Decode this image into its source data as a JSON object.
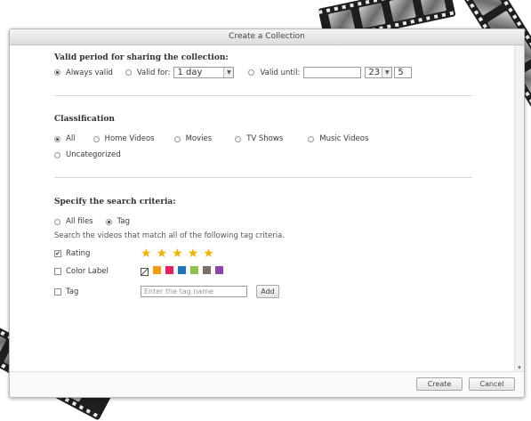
{
  "dialog": {
    "title": "Create a Collection"
  },
  "valid_period": {
    "heading": "Valid period for sharing the collection:",
    "options": {
      "always": "Always valid",
      "valid_for": "Valid for:",
      "valid_until": "Valid until:"
    },
    "selected": "always",
    "valid_for_value": "1 day",
    "valid_until_date": "",
    "hour_value": "23",
    "minute_value": "5"
  },
  "classification": {
    "heading": "Classification",
    "options": [
      "All",
      "Home Videos",
      "Movies",
      "TV Shows",
      "Music Videos",
      "Uncategorized"
    ],
    "selected": "All"
  },
  "search": {
    "heading": "Specify the search criteria:",
    "options": {
      "all_files": "All files",
      "tag": "Tag"
    },
    "selected": "tag",
    "description": "Search the videos that match all of the following tag criteria.",
    "rating": {
      "label": "Rating",
      "checked": true,
      "stars": 5
    },
    "color_label": {
      "label": "Color Label",
      "checked": false,
      "colors": [
        "#f39c12",
        "#e91e63",
        "#1e73be",
        "#8bc34a",
        "#7a7265",
        "#8e44ad"
      ]
    },
    "tag": {
      "label": "Tag",
      "checked": false,
      "placeholder": "Enter the tag name",
      "add_label": "Add"
    }
  },
  "footer": {
    "create_label": "Create",
    "cancel_label": "Cancel"
  }
}
